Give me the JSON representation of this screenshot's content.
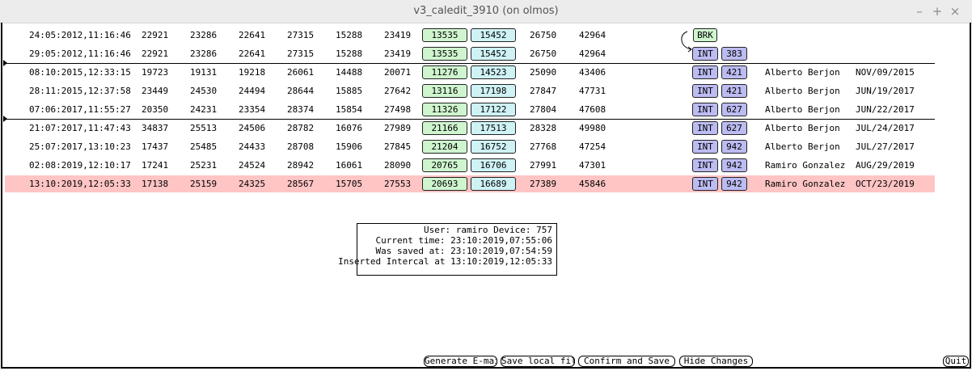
{
  "window": {
    "title": "v3_caledit_3910 (on olmos)",
    "controls": [
      "–",
      "+",
      "×"
    ]
  },
  "rows": [
    {
      "ts": "24:05:2012,11:16:46",
      "v1": "22921",
      "v2": "23286",
      "v3": "22641",
      "v4": "27315",
      "v5": "15288",
      "v6": "23419",
      "g": "13535",
      "c": "15452",
      "v9": "26750",
      "v10": "42964",
      "type": "BRK",
      "num": "",
      "user": "",
      "date": ""
    },
    {
      "ts": "29:05:2012,11:16:46",
      "v1": "22921",
      "v2": "23286",
      "v3": "22641",
      "v4": "27315",
      "v5": "15288",
      "v6": "23419",
      "g": "13535",
      "c": "15452",
      "v9": "26750",
      "v10": "42964",
      "type": "INT",
      "num": "383",
      "user": "",
      "date": ""
    },
    {
      "ts": "08:10:2015,12:33:15",
      "v1": "19723",
      "v2": "19131",
      "v3": "19218",
      "v4": "26061",
      "v5": "14488",
      "v6": "20071",
      "g": "11276",
      "c": "14523",
      "v9": "25090",
      "v10": "43406",
      "type": "INT",
      "num": "421",
      "user": "Alberto Berjon",
      "date": "NOV/09/2015"
    },
    {
      "ts": "28:11:2015,12:37:58",
      "v1": "23449",
      "v2": "24530",
      "v3": "24494",
      "v4": "28644",
      "v5": "15885",
      "v6": "27642",
      "g": "13116",
      "c": "17198",
      "v9": "27847",
      "v10": "47731",
      "type": "INT",
      "num": "421",
      "user": "Alberto Berjon",
      "date": "JUN/19/2017"
    },
    {
      "ts": "07:06:2017,11:55:27",
      "v1": "20350",
      "v2": "24231",
      "v3": "23354",
      "v4": "28374",
      "v5": "15854",
      "v6": "27498",
      "g": "11326",
      "c": "17122",
      "v9": "27804",
      "v10": "47608",
      "type": "INT",
      "num": "627",
      "user": "Alberto Berjon",
      "date": "JUN/22/2017"
    },
    {
      "ts": "21:07:2017,11:47:43",
      "v1": "34837",
      "v2": "25513",
      "v3": "24506",
      "v4": "28782",
      "v5": "16076",
      "v6": "27989",
      "g": "21166",
      "c": "17513",
      "v9": "28328",
      "v10": "49980",
      "type": "INT",
      "num": "627",
      "user": "Alberto Berjon",
      "date": "JUL/24/2017"
    },
    {
      "ts": "25:07:2017,13:10:23",
      "v1": "17437",
      "v2": "25485",
      "v3": "24433",
      "v4": "28708",
      "v5": "15906",
      "v6": "27845",
      "g": "21204",
      "c": "16752",
      "v9": "27768",
      "v10": "47254",
      "type": "INT",
      "num": "942",
      "user": "Alberto Berjon",
      "date": "JUL/27/2017"
    },
    {
      "ts": "02:08:2019,12:10:17",
      "v1": "17241",
      "v2": "25231",
      "v3": "24524",
      "v4": "28942",
      "v5": "16061",
      "v6": "28090",
      "g": "20765",
      "c": "16706",
      "v9": "27991",
      "v10": "47301",
      "type": "INT",
      "num": "942",
      "user": "Ramiro Gonzalez",
      "date": "AUG/29/2019"
    },
    {
      "ts": "13:10:2019,12:05:33",
      "v1": "17138",
      "v2": "25159",
      "v3": "24325",
      "v4": "28567",
      "v5": "15705",
      "v6": "27553",
      "g": "20693",
      "c": "16689",
      "v9": "27389",
      "v10": "45846",
      "type": "INT",
      "num": "942",
      "user": "Ramiro Gonzalez",
      "date": "OCT/23/2019"
    }
  ],
  "selected_row": 8,
  "separators_after": [
    1,
    4
  ],
  "info": {
    "user_line": "User: ramiro Device: 757",
    "current_line": "Current time: 23:10:2019,07:55:06",
    "saved_line": "Was saved at: 23:10:2019,07:54:59",
    "inserted_line": "Inserted Intercal at 13:10:2019,12:05:33"
  },
  "buttons": {
    "email": "Generate E-mail",
    "save_local": "Save local file",
    "confirm": "Confirm and Save",
    "hide": "Hide Changes",
    "quit": "Quit"
  },
  "colors": {
    "selected_row": "#ffc4c4",
    "green_tag": "#cff5cf",
    "cyan_tag": "#cff2f5",
    "purple_tag": "#bcbcf2"
  }
}
